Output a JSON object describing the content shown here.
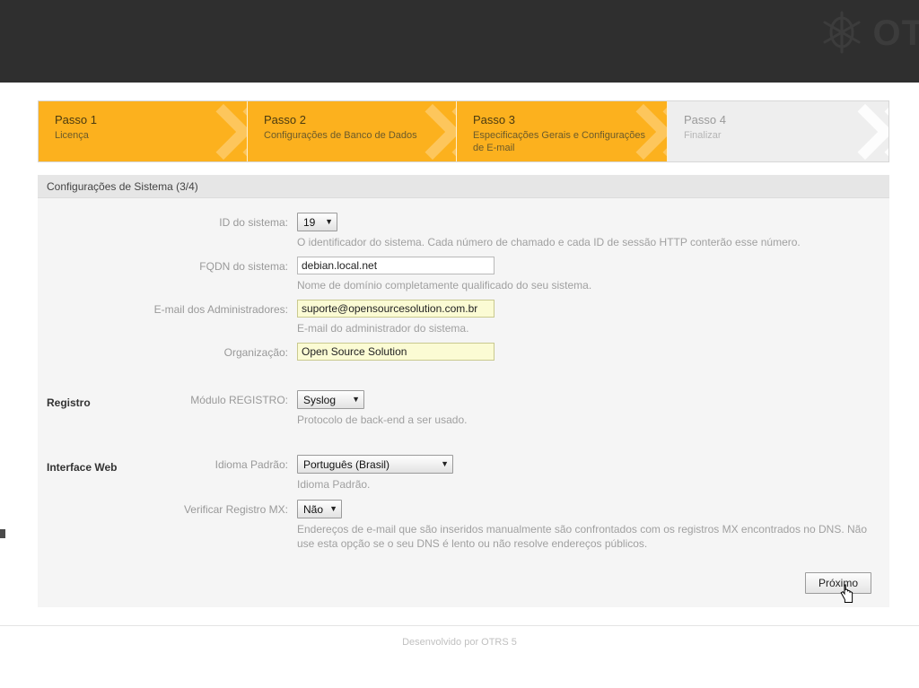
{
  "header": {
    "logo_icon": "otrs-asterisk-icon",
    "brand_text": "OT"
  },
  "steps": [
    {
      "title": "Passo 1",
      "subtitle": "Licença",
      "state": "active"
    },
    {
      "title": "Passo 2",
      "subtitle": "Configurações de Banco de Dados",
      "state": "active"
    },
    {
      "title": "Passo 3",
      "subtitle": "Especificações Gerais e Configurações de E-mail",
      "state": "active"
    },
    {
      "title": "Passo 4",
      "subtitle": "Finalizar",
      "state": "inactive"
    }
  ],
  "panel": {
    "title": "Configurações de Sistema (3/4)"
  },
  "sections": {
    "registro": "Registro",
    "interface_web": "Interface Web"
  },
  "fields": {
    "system_id": {
      "label": "ID do sistema:",
      "value": "19",
      "hint": "O identificador do sistema. Cada número de chamado e cada ID de sessão HTTP conterão esse número."
    },
    "fqdn": {
      "label": "FQDN do sistema:",
      "value": "debian.local.net",
      "placeholder": "",
      "hint": "Nome de domínio completamente qualificado do seu sistema."
    },
    "admin_email": {
      "label": "E-mail dos Administradores:",
      "value": "suporte@opensourcesolution.com.br",
      "placeholder": "",
      "hint": "E-mail do administrador do sistema."
    },
    "organization": {
      "label": "Organização:",
      "value": "Open Source Solution",
      "placeholder": "",
      "hint": ""
    },
    "log_module": {
      "label": "Módulo REGISTRO:",
      "value": "Syslog",
      "hint": "Protocolo de back-end a ser usado."
    },
    "default_language": {
      "label": "Idioma Padrão:",
      "value": "Português (Brasil)",
      "hint": "Idioma Padrão."
    },
    "check_mx": {
      "label": "Verificar Registro MX:",
      "value": "Não",
      "hint": "Endereços de e-mail que são inseridos manualmente são confrontados com os registros MX encontrados no DNS. Não use esta opção se o seu DNS é lento ou não resolve endereços públicos."
    }
  },
  "buttons": {
    "next": "Próximo"
  },
  "footer": {
    "text": "Desenvolvido por OTRS 5"
  },
  "colors": {
    "accent": "#fcb11e",
    "header_dark": "#2f2f2f",
    "panel_bg": "#f5f5f5",
    "panel_header_bg": "#e6e6e6",
    "highlight_field": "#fbfbd4"
  }
}
